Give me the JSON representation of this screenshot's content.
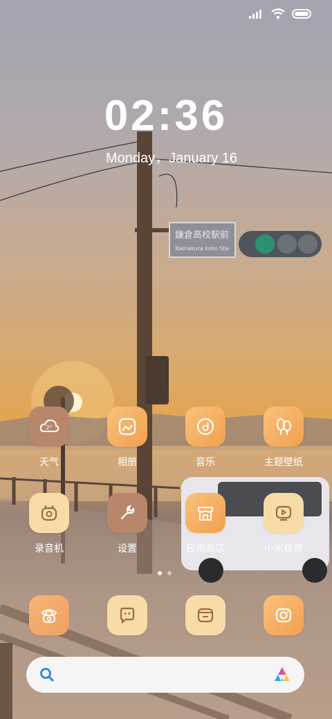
{
  "status_bar": {
    "signal_icon": "cellular-signal-icon",
    "wifi_icon": "wifi-icon",
    "battery_icon": "battery-icon"
  },
  "lock": {
    "time": "02:36",
    "date": "Monday，January 16"
  },
  "apps_row1": [
    {
      "label": "天气",
      "icon": "weather-icon"
    },
    {
      "label": "相册",
      "icon": "gallery-icon"
    },
    {
      "label": "音乐",
      "icon": "music-icon"
    },
    {
      "label": "主题壁纸",
      "icon": "themes-icon"
    }
  ],
  "apps_row2": [
    {
      "label": "录音机",
      "icon": "recorder-icon"
    },
    {
      "label": "设置",
      "icon": "settings-icon"
    },
    {
      "label": "应用商店",
      "icon": "app-store-icon"
    },
    {
      "label": "小米视频",
      "icon": "video-icon"
    }
  ],
  "dock": [
    {
      "icon": "phone-icon"
    },
    {
      "icon": "messages-icon"
    },
    {
      "icon": "browser-icon"
    },
    {
      "icon": "camera-icon"
    }
  ],
  "page_indicator": {
    "pages": 2,
    "current": 1
  },
  "search_bar": {
    "search_icon": "search-icon",
    "assistant_icon": "assistant-icon"
  },
  "wallpaper": {
    "sign_text": "鎌倉高校駅前",
    "sign_subtext": "Kamakura koko Sta"
  },
  "colors": {
    "accent_orange": "#f2a04d",
    "cream": "#f8dca7",
    "brown": "#b8876b",
    "icon_stroke": "#9a6a4a"
  }
}
